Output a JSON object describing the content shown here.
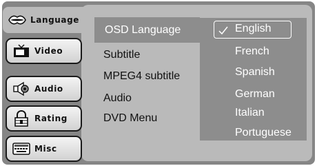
{
  "tabs": [
    {
      "label": "Language",
      "icon": "lips-icon",
      "active": true
    },
    {
      "label": "Video",
      "icon": "tv-icon",
      "active": false
    },
    {
      "label": "Audio",
      "icon": "speaker-icon",
      "active": false
    },
    {
      "label": "Rating",
      "icon": "lock-icon",
      "active": false
    },
    {
      "label": "Misc",
      "icon": "keyboard-icon",
      "active": false
    }
  ],
  "menu": {
    "selected_label": "OSD Language",
    "items": [
      "Subtitle",
      "MPEG4 subtitle",
      "Audio",
      "DVD Menu"
    ]
  },
  "options": {
    "selected": "English",
    "items": [
      "English",
      "French",
      "Spanish",
      "German",
      "Italian",
      "Portuguese"
    ]
  },
  "colors": {
    "frame": "#868686",
    "panel": "#bababa",
    "highlight": "#8d8d8d",
    "text_selected": "#ffffff"
  }
}
